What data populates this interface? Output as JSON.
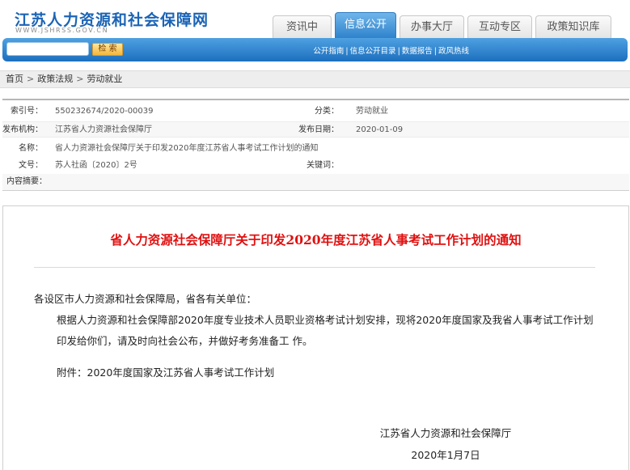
{
  "site": {
    "title": "江苏人力资源和社会保障网",
    "url_text": "WWW.JSHRSS.GOV.CN"
  },
  "nav": {
    "tabs": [
      {
        "label": "资讯中心",
        "active": false
      },
      {
        "label": "信息公开",
        "active": true
      },
      {
        "label": "办事大厅",
        "active": false
      },
      {
        "label": "互动专区",
        "active": false
      },
      {
        "label": "政策知识库",
        "active": false
      }
    ]
  },
  "search": {
    "placeholder": "",
    "button_label": "检 索"
  },
  "quicklinks": [
    "公开指南",
    "信息公开目录",
    "数据报告",
    "政风热线"
  ],
  "breadcrumb": {
    "items": [
      "首页",
      "政策法规",
      "劳动就业"
    ],
    "separator": ">"
  },
  "meta": {
    "index_label": "索引号：",
    "index_value": "550232674/2020-00039",
    "category_label": "分类：",
    "category_value": "劳动就业",
    "publisher_label": "发布机构：",
    "publisher_value": "江苏省人力资源社会保障厅",
    "date_label": "发布日期：",
    "date_value": "2020-01-09",
    "name_label": "名称：",
    "name_value": "省人力资源社会保障厅关于印发2020年度江苏省人事考试工作计划的通知",
    "docno_label": "文号：",
    "docno_value": "苏人社函〔2020〕2号",
    "keywords_label": "关键词：",
    "keywords_value": "",
    "summary_label": "内容摘要：",
    "summary_value": ""
  },
  "article": {
    "title": "省人力资源社会保障厅关于印发2020年度江苏省人事考试工作计划的通知",
    "salutation": "各设区市人力资源和社会保障局，省各有关单位：",
    "body": "根据人力资源和社会保障部2020年度专业技术人员职业资格考试计划安排，现将2020年度国家及我省人事考试工作计划印发给你们，请及时向社会公布，并做好考务准备工 作。",
    "attachment": "附件：2020年度国家及江苏省人事考试工作计划",
    "signature": "江苏省人力资源和社会保障厅",
    "date": "2020年1月7日"
  },
  "colors": {
    "brand_blue": "#1b64b6",
    "title_red": "#e01010",
    "active_tab": "#2f83cc"
  }
}
